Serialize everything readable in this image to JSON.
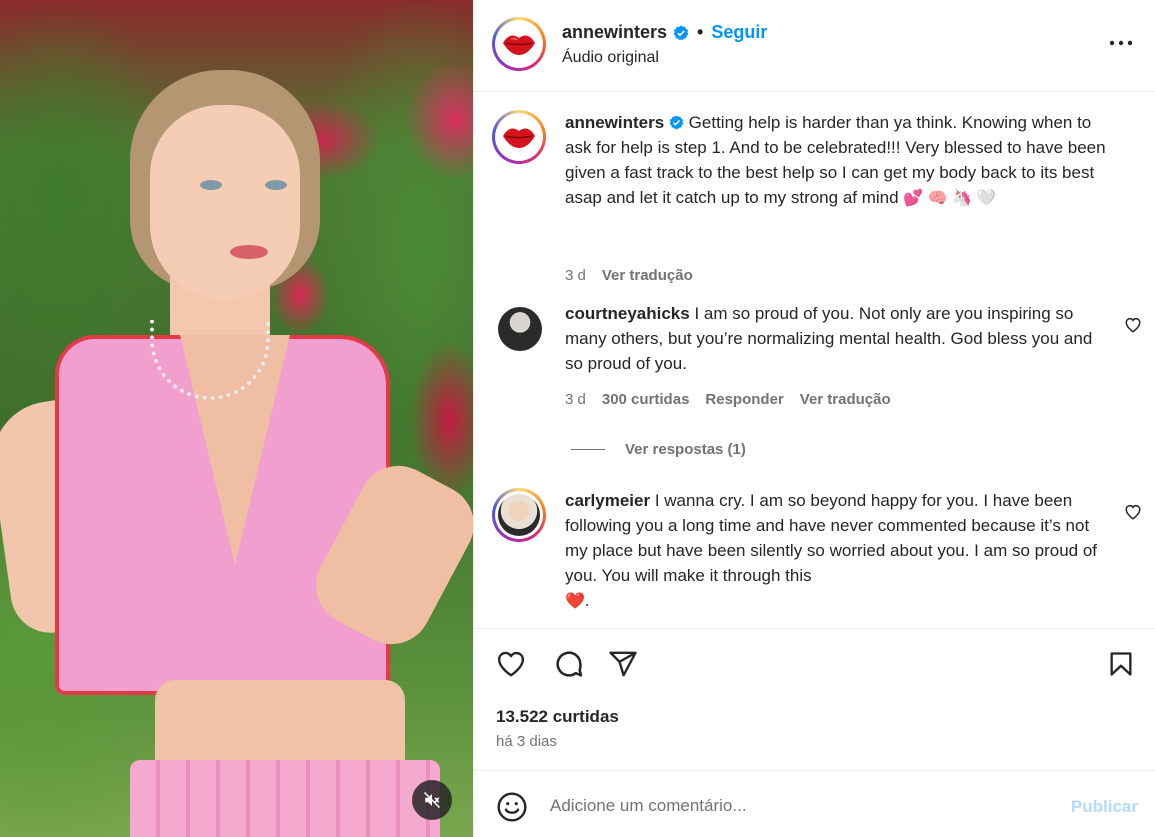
{
  "media": {
    "description_icon": "mute-icon"
  },
  "header": {
    "username": "annewinters",
    "separator": "•",
    "follow_label": "Seguir",
    "audio_label": "Áudio original",
    "more_icon": "more-horizontal-icon"
  },
  "caption": {
    "username": "annewinters",
    "text": "Getting help is harder than ya think. Knowing when to ask for help is step 1. And to be celebrated!!! Very blessed to have been given a fast track to the best help so I can get my body back to its best asap and let it catch up to my strong af mind",
    "emojis": "💕 🧠 🦄 🤍",
    "age": "3 d",
    "translate_label": "Ver tradução"
  },
  "comments": [
    {
      "username": "courtneyahicks",
      "text": "I am so proud of you. Not only are you inspiring so many others, but you’re normalizing mental health. God bless you and so proud of you.",
      "age": "3 d",
      "likes": "300 curtidas",
      "reply_label": "Responder",
      "translate_label": "Ver tradução",
      "view_replies": "Ver respostas (1)"
    },
    {
      "username": "carlymeier",
      "text": "I wanna cry. I am so beyond happy for you. I have been following you a long time and have never commented because it’s not my place but have been silently so worried about you. I am so proud of you. You will make it through this",
      "trailing_emoji": "❤️",
      "trailing_punct": "."
    }
  ],
  "actions": {
    "like_icon": "heart-icon",
    "comment_icon": "comment-icon",
    "share_icon": "paper-plane-icon",
    "save_icon": "bookmark-icon",
    "likes_count": "13.522 curtidas",
    "posted_ago": "há 3 dias"
  },
  "add_comment": {
    "placeholder": "Adicione um comentário...",
    "publish_label": "Publicar",
    "emoji_icon": "smiley-icon"
  },
  "colors": {
    "link_blue": "#0095f6",
    "publish_disabled": "#b3dbff",
    "verified_blue": "#0095f6",
    "secondary_text": "#737373"
  }
}
